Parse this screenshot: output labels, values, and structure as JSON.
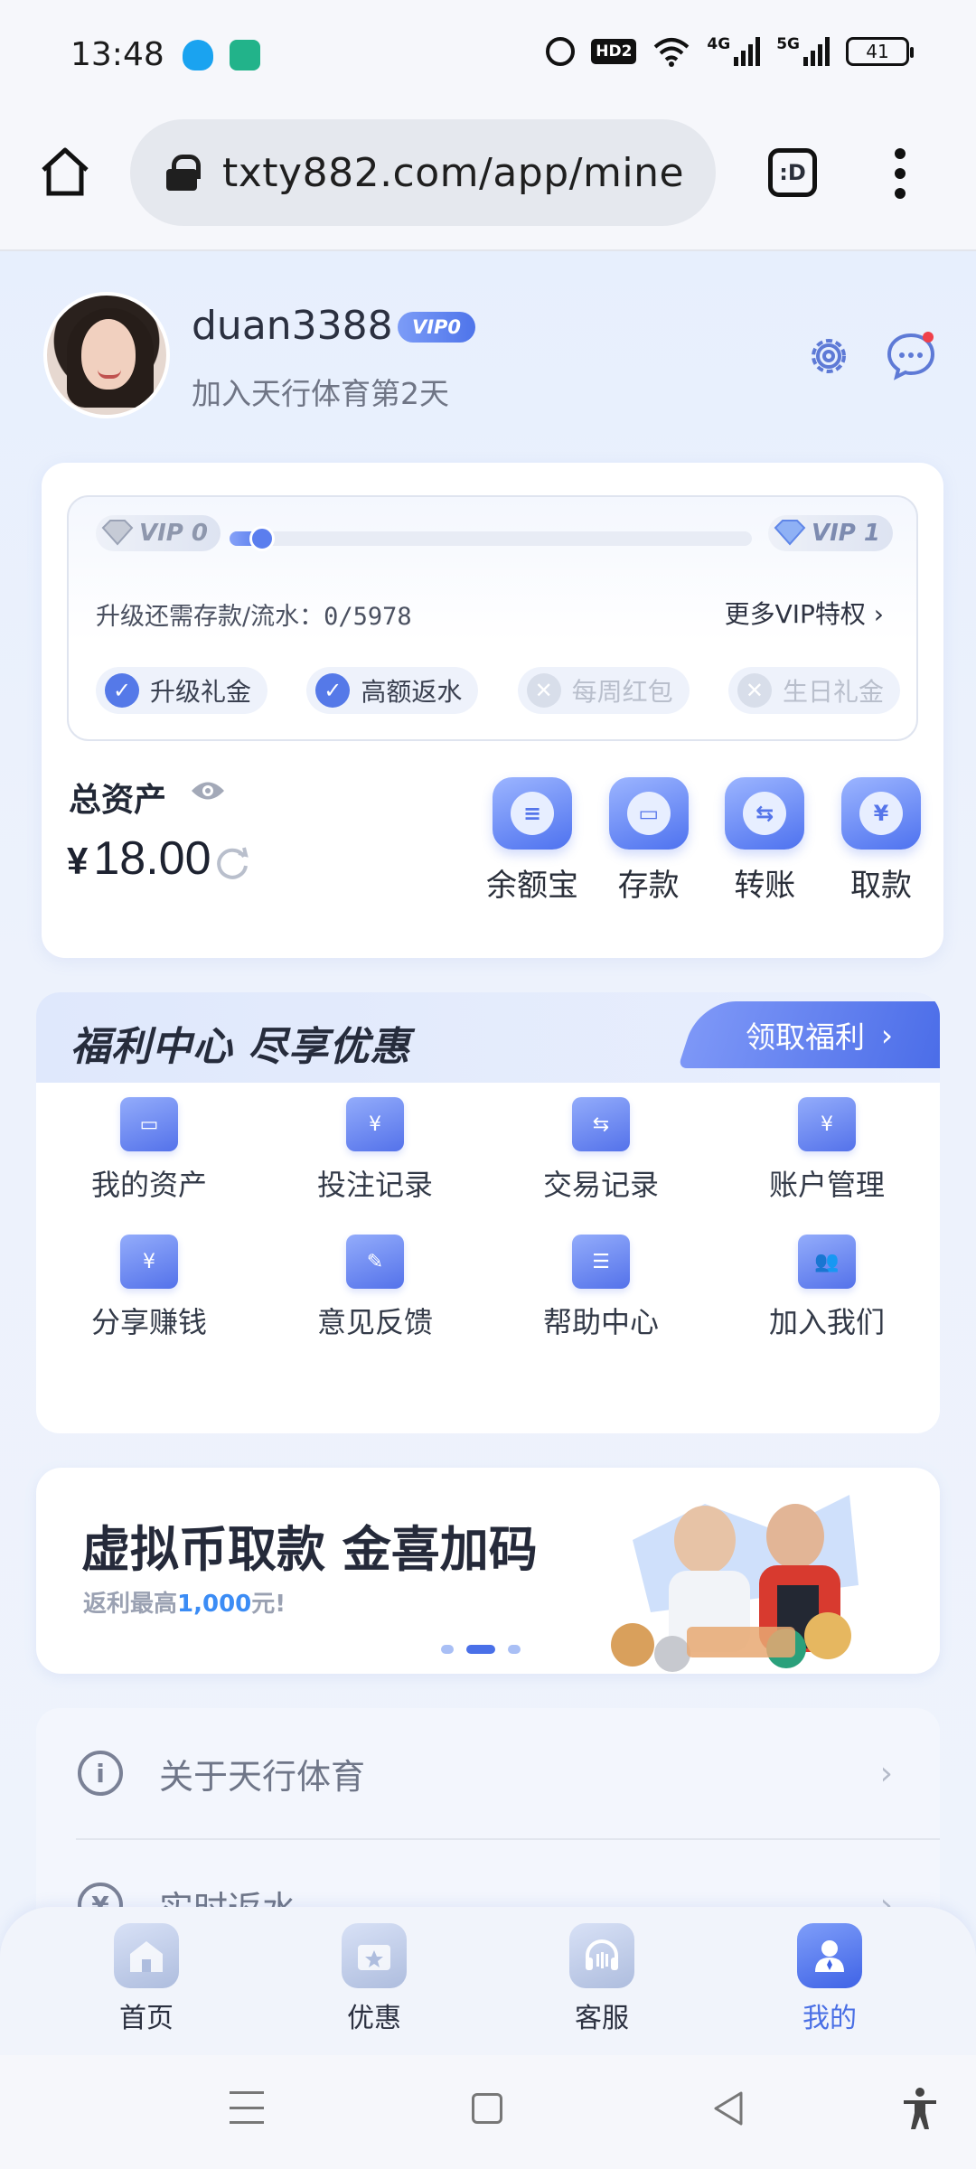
{
  "status_bar": {
    "time": "13:48",
    "network_4g": "4G",
    "network_5g": "5G",
    "hd_label": "HD2",
    "battery": "41"
  },
  "browser": {
    "url": "txty882.com/app/mine",
    "tab_button_label": ":D"
  },
  "profile": {
    "username": "duan3388",
    "vip_level": "VIP0",
    "join_text": "加入天行体育第2天"
  },
  "vip_progress": {
    "from_level": "VIP 0",
    "to_level": "VIP 1",
    "progress_fraction": 0.06,
    "upgrade_label": "升级还需存款/流水：",
    "upgrade_value": "0/5978",
    "more_link": "更多VIP特权",
    "perks": [
      {
        "label": "升级礼金",
        "enabled": true
      },
      {
        "label": "高额返水",
        "enabled": true
      },
      {
        "label": "每周红包",
        "enabled": false
      },
      {
        "label": "生日礼金",
        "enabled": false
      }
    ]
  },
  "assets": {
    "title": "总资产",
    "currency": "¥",
    "amount": "18.00",
    "actions": [
      {
        "label": "余额宝",
        "icon": "coin-stack-icon",
        "glyph": "≡"
      },
      {
        "label": "存款",
        "icon": "wallet-icon",
        "glyph": "▭"
      },
      {
        "label": "转账",
        "icon": "transfer-icon",
        "glyph": "⇆"
      },
      {
        "label": "取款",
        "icon": "withdraw-icon",
        "glyph": "¥"
      }
    ]
  },
  "welfare": {
    "title": "福利中心 尽享优惠",
    "button": "领取福利",
    "items": [
      {
        "label": "我的资产",
        "icon": "wallet-icon",
        "glyph": "▭"
      },
      {
        "label": "投注记录",
        "icon": "bet-record-icon",
        "glyph": "¥"
      },
      {
        "label": "交易记录",
        "icon": "transaction-icon",
        "glyph": "⇆"
      },
      {
        "label": "账户管理",
        "icon": "account-folder-icon",
        "glyph": "¥"
      },
      {
        "label": "分享赚钱",
        "icon": "share-earn-icon",
        "glyph": "¥"
      },
      {
        "label": "意见反馈",
        "icon": "feedback-icon",
        "glyph": "✎"
      },
      {
        "label": "帮助中心",
        "icon": "help-book-icon",
        "glyph": "☰"
      },
      {
        "label": "加入我们",
        "icon": "users-icon",
        "glyph": "👥"
      }
    ]
  },
  "banner": {
    "title": "虚拟币取款 金喜加码",
    "subtitle_prefix": "返利最高",
    "subtitle_highlight": "1,000",
    "subtitle_suffix": "元!",
    "slides": 3,
    "active_slide": 2
  },
  "menu": [
    {
      "label": "关于天行体育",
      "icon": "info-icon",
      "glyph": "i"
    },
    {
      "label": "实时返水",
      "icon": "rebate-icon",
      "glyph": "¥"
    }
  ],
  "tabbar": [
    {
      "label": "首页",
      "icon": "home-icon",
      "active": false
    },
    {
      "label": "优惠",
      "icon": "gift-icon",
      "active": false
    },
    {
      "label": "客服",
      "icon": "headset-icon",
      "active": false
    },
    {
      "label": "我的",
      "icon": "profile-icon",
      "active": true
    }
  ]
}
